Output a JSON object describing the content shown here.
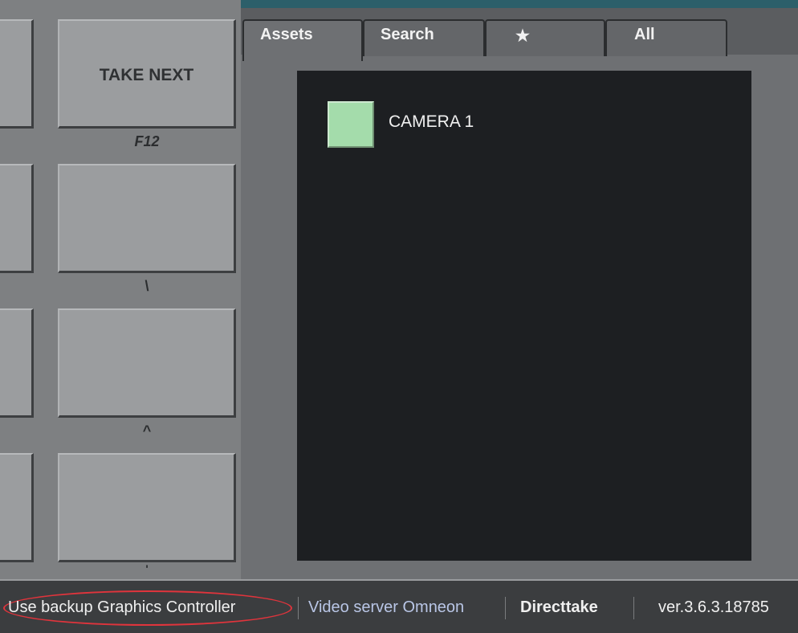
{
  "keypad": {
    "keys": [
      {
        "label": "TAKE NEXT",
        "hotkey": "F12"
      },
      {
        "label": "",
        "hotkey": "\\"
      },
      {
        "label": "",
        "hotkey": "^"
      },
      {
        "label": "",
        "hotkey": "'"
      }
    ]
  },
  "tabs": [
    {
      "label": "Assets",
      "active": true
    },
    {
      "label": "Search",
      "active": false
    },
    {
      "label": "★",
      "active": false
    },
    {
      "label": "All",
      "active": false
    }
  ],
  "assets": [
    {
      "label": "CAMERA 1",
      "color": "#a4dcab"
    }
  ],
  "status_bar": {
    "backup_controller": "Use backup Graphics Controller",
    "video_server": "Video server Omneon",
    "mode": "Directtake",
    "version": "ver.3.6.3.18785"
  },
  "colors": {
    "accent_strip": "#2c5f6a",
    "highlight_ring": "#e0343c"
  }
}
